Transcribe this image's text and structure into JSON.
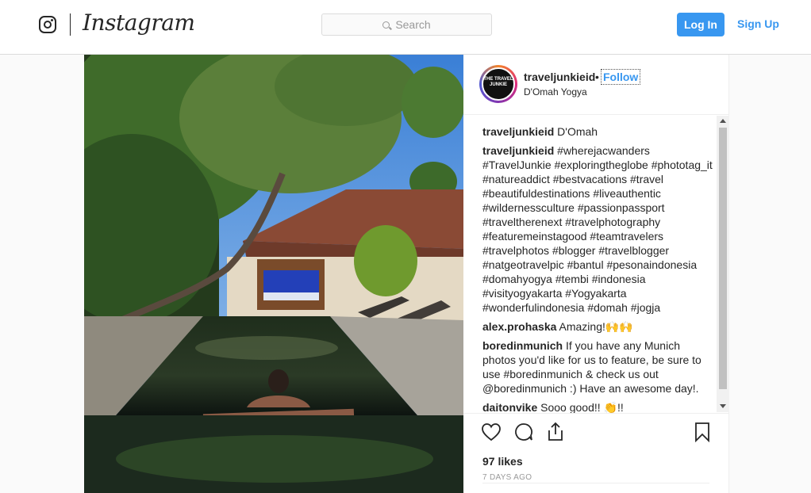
{
  "header": {
    "brand": "Instagram",
    "search_placeholder": "Search",
    "login_label": "Log In",
    "signup_label": "Sign Up"
  },
  "post": {
    "author": "traveljunkieid",
    "separator": "•",
    "follow_label": "Follow",
    "location": "D'Omah Yogya",
    "avatar_text": "THE TRAVEL JUNKIE",
    "comments": [
      {
        "user": "traveljunkieid",
        "text": "D'Omah"
      },
      {
        "user": "traveljunkieid",
        "text": "#wherejacwanders #TravelJunkie #exploringtheglobe #phototag_it #natureaddict #bestvacations #travel #beautifuldestinations #liveauthentic #wildernessculture #passionpassport  #traveltherenext #travelphotography #featuremeinstagood #teamtravelers #travelphotos #blogger #travelblogger #natgeotravelpic #bantul #pesonaindonesia #domahyogya #tembi #indonesia #visityogyakarta #Yogyakarta #wonderfulindonesia #domah #jogja"
      },
      {
        "user": "alex.prohaska",
        "text": "Amazing!🙌🙌"
      },
      {
        "user": "boredinmunich",
        "text": "If you have any Munich photos you'd like for us to feature, be sure to use #boredinmunich & check us out @boredinmunich :) Have an awesome day!."
      },
      {
        "user": "daitonvike",
        "text": "Sooo good!! 👏!!"
      }
    ],
    "likes": "97 likes",
    "time": "7 DAYS AGO"
  },
  "icons": {
    "logo": "instagram-glyph-icon",
    "search": "search-icon",
    "like": "heart-icon",
    "comment": "comment-icon",
    "share": "share-icon",
    "save": "bookmark-icon"
  },
  "colors": {
    "accent": "#3897f0",
    "hashtag": "#003569",
    "border": "#dbdbdb"
  }
}
